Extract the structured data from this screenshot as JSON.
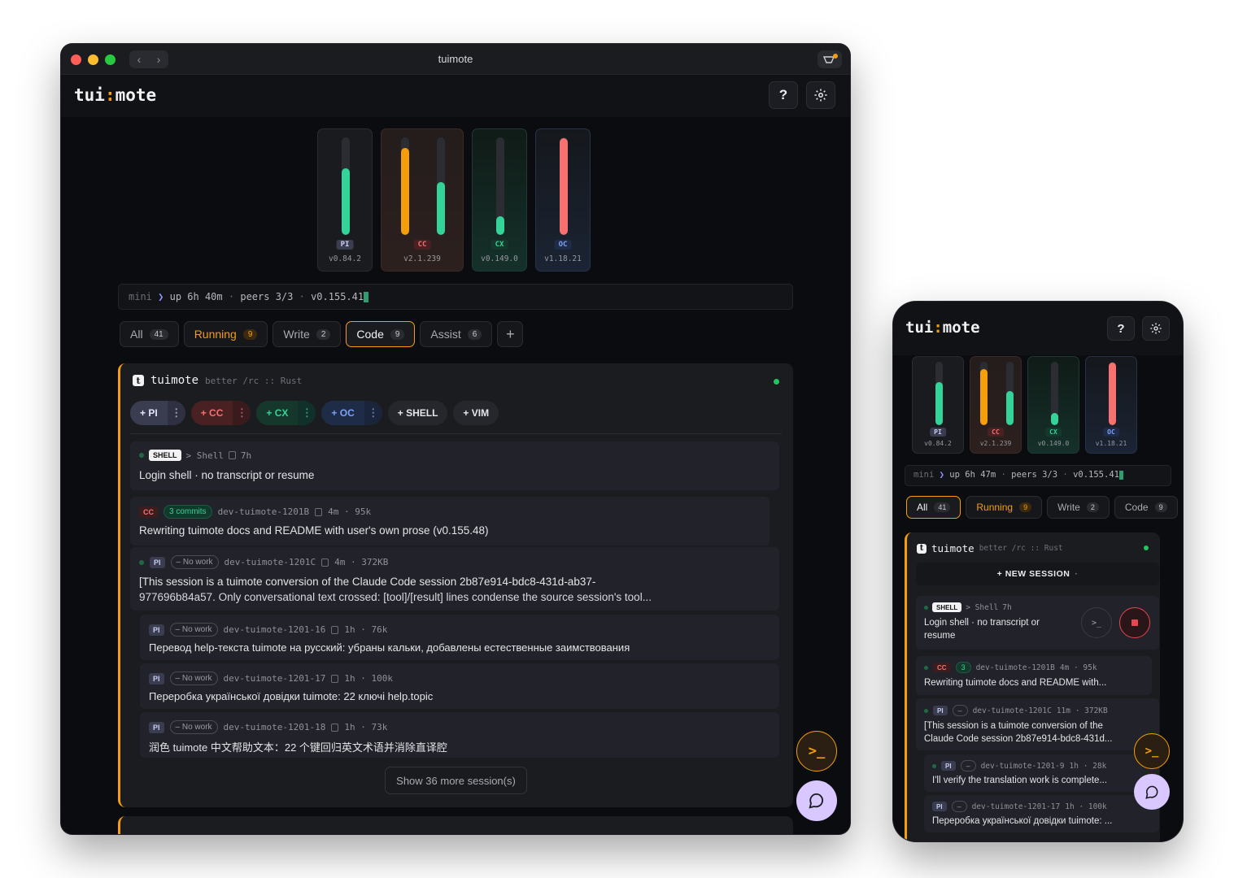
{
  "window": {
    "title": "tuimote",
    "nav_back": "‹",
    "nav_forward": "›",
    "traffic_lights": {
      "close": "#ff5f57",
      "minimize": "#febc2e",
      "zoom": "#28c840"
    }
  },
  "app": {
    "logo_left": "tui",
    "logo_colon": ":",
    "logo_right": "mote",
    "help_label": "?",
    "settings_icon": "gear-icon",
    "accent": "#f59e0b"
  },
  "agents": [
    {
      "badge": "PI",
      "version": "v0.84.2",
      "levels": [
        0.68
      ],
      "colors": [
        "#34d399"
      ],
      "badge_bg": "#3a3c50",
      "badge_fg": "#c9cbf0"
    },
    {
      "badge": "CC",
      "version": "v2.1.239",
      "levels": [
        0.89,
        0.54
      ],
      "colors": [
        "#f59e0b",
        "#34d399"
      ],
      "badge_bg": "#4a2123",
      "badge_fg": "#f87171"
    },
    {
      "badge": "CX",
      "version": "v0.149.0",
      "levels": [
        0.19
      ],
      "colors": [
        "#34d399"
      ],
      "badge_bg": "#16382c",
      "badge_fg": "#34d399"
    },
    {
      "badge": "OC",
      "version": "v1.18.21",
      "levels": [
        0.99
      ],
      "colors": [
        "#f87171"
      ],
      "badge_bg": "#1f2c47",
      "badge_fg": "#7aa2f7"
    }
  ],
  "status": {
    "host": "mini",
    "arrow": "❯",
    "uptime_desktop": "up 6h 40m",
    "uptime_phone": "up 6h 47m",
    "sep": "·",
    "peers": "peers 3/3",
    "version": "v0.155.41"
  },
  "tabs": [
    {
      "label": "All",
      "count": "41"
    },
    {
      "label": "Running",
      "count": "9"
    },
    {
      "label": "Write",
      "count": "2"
    },
    {
      "label": "Code",
      "count": "9"
    },
    {
      "label": "Assist",
      "count": "6"
    }
  ],
  "add_tab_label": "+",
  "project": {
    "logo": "t",
    "name": "tuimote",
    "subtitle": "better /rc :: Rust"
  },
  "launch_pills": [
    {
      "label": "+ PI",
      "more": "⋮"
    },
    {
      "label": "+ CC",
      "more": "⋮"
    },
    {
      "label": "+ CX",
      "more": "⋮"
    },
    {
      "label": "+ OC",
      "more": "⋮"
    },
    {
      "label": "+ SHELL"
    },
    {
      "label": "+ VIM"
    }
  ],
  "sessions": [
    {
      "tag": "SHELL",
      "meta": "> Shell",
      "age": "7h",
      "text": "Login shell · no transcript or resume"
    },
    {
      "tag": "CC",
      "chip": "3 commits",
      "name": "dev-tuimote-1201B",
      "age": "4m · 95k",
      "text": "Rewriting tuimote docs and README with user's own prose (v0.155.48)"
    },
    {
      "tag": "PI",
      "chip": "– No work",
      "name": "dev-tuimote-1201C",
      "age": "4m · 372KB",
      "text1": "[This session is a tuimote conversion of the Claude Code session 2b87e914-bdc8-431d-ab37-",
      "text2": "977696b84a57. Only conversational text crossed: [tool]/[result] lines condense the source session's tool..."
    },
    {
      "tag": "PI",
      "chip": "– No work",
      "name": "dev-tuimote-1201-16",
      "age": "1h · 76k",
      "text": "Перевод help-текста tuimote на русский: убраны кальки, добавлены естественные заимствования"
    },
    {
      "tag": "PI",
      "chip": "– No work",
      "name": "dev-tuimote-1201-17",
      "age": "1h · 100k",
      "text": "Переробка української довідки tuimote: 22 ключі help.topic"
    },
    {
      "tag": "PI",
      "chip": "– No work",
      "name": "dev-tuimote-1201-18",
      "age": "1h · 73k",
      "text": "润色 tuimote 中文帮助文本：22 个键回归英文术语并消除直译腔"
    }
  ],
  "show_more": "Show 36 more session(s)",
  "fab_terminal": ">_",
  "phone": {
    "new_session": "+ NEW SESSION",
    "new_session_caret": "·",
    "sessions": [
      {
        "tag": "SHELL",
        "meta": "> Shell",
        "age": "7h",
        "text1": "Login shell · no transcript or",
        "text2": "resume"
      },
      {
        "tag": "CC",
        "chip": "3",
        "name": "dev-tuimote-1201B",
        "age": "4m · 95k",
        "text": "Rewriting tuimote docs and README with..."
      },
      {
        "tag": "PI",
        "chip": "–",
        "name": "dev-tuimote-1201C",
        "age": "11m · 372KB",
        "text1": "[This session is a tuimote conversion of the",
        "text2": "Claude Code session 2b87e914-bdc8-431d..."
      },
      {
        "tag": "PI",
        "chip": "–",
        "name": "dev-tuimote-1201-9",
        "age": "1h · 28k",
        "text": "I'll verify the translation work is complete..."
      },
      {
        "tag": "PI",
        "chip": "–",
        "name": "dev-tuimote-1201-17",
        "age": "1h · 100k",
        "text": "Переробка української довідки tuimote: ..."
      }
    ]
  }
}
